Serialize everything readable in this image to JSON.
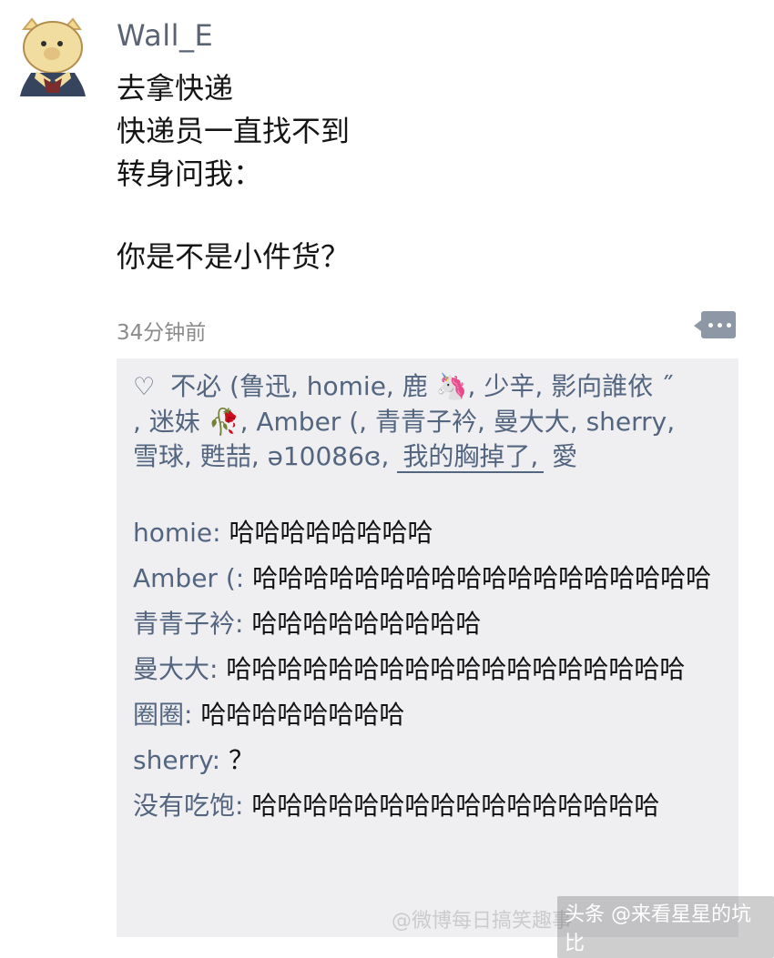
{
  "post": {
    "username": "Wall_E",
    "lines": [
      "去拿快递",
      "快递员一直找不到",
      "转身问我：",
      "你是不是小件货？"
    ],
    "time": "34分钟前"
  },
  "likes": {
    "text_parts": [
      "不必 (鲁迅,",
      "homie,",
      "鹿 🦄,",
      "少辛,",
      "影向誰依 ˝",
      ", 迷妹 🥀,",
      "Amber (,",
      "青青子衿,",
      "曼大大,",
      "sherry,",
      "雪球,",
      "甦喆,",
      "ə10086ɞ,",
      "我的胸掉了,",
      "愛"
    ]
  },
  "comments": [
    {
      "name": "homie",
      "text": "哈哈哈哈哈哈哈哈"
    },
    {
      "name": "Amber (",
      "text": "哈哈哈哈哈哈哈哈哈哈哈哈哈哈哈哈哈哈"
    },
    {
      "name": "青青子衿",
      "text": "哈哈哈哈哈哈哈哈哈"
    },
    {
      "name": "曼大大",
      "text": "哈哈哈哈哈哈哈哈哈哈哈哈哈哈哈哈哈哈"
    },
    {
      "name": "圈圈",
      "text": "哈哈哈哈哈哈哈哈"
    },
    {
      "name": "sherry",
      "text": "？"
    },
    {
      "name": "没有吃饱",
      "text": "哈哈哈哈哈哈哈哈哈哈哈哈哈哈哈哈"
    }
  ],
  "watermark": "@微博每日搞笑趣事",
  "footer": "头条 @来看星星的坑比"
}
